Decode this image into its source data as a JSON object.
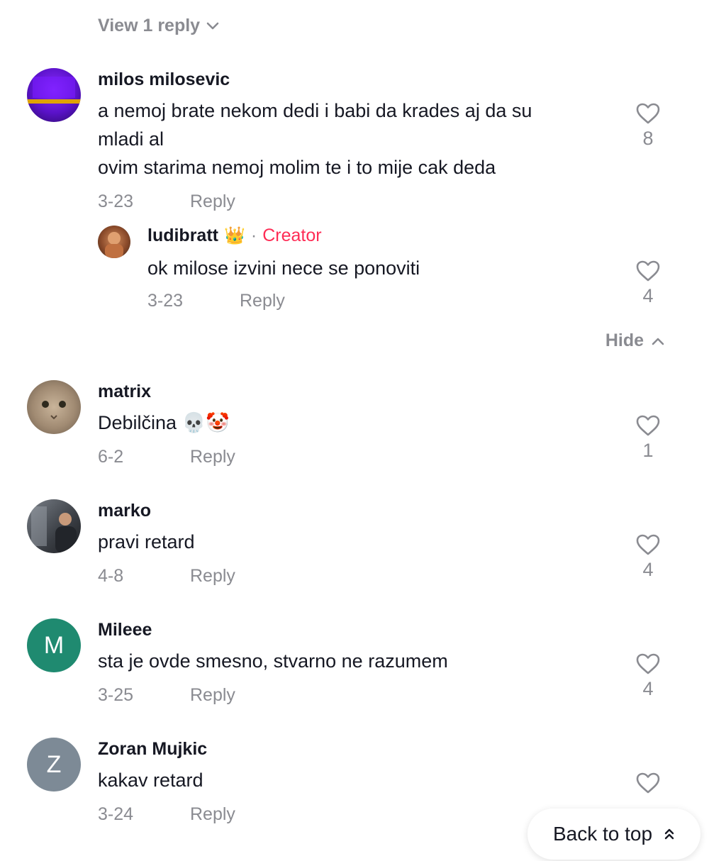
{
  "top": {
    "view_replies_label": "View 1 reply"
  },
  "comments": [
    {
      "username": "milos milosevic",
      "text_line1": "a nemoj brate nekom dedi i babi da krades aj da su",
      "text_line2": "mladi al",
      "text_line3": "ovim starima nemoj molim te i to mije cak deda",
      "date": "3-23",
      "reply_label": "Reply",
      "likes": "8"
    },
    {
      "username": "matrix",
      "text": "Debilčina 💀🤡",
      "date": "6-2",
      "reply_label": "Reply",
      "likes": "1"
    },
    {
      "username": "marko",
      "text": "pravi retard",
      "date": "4-8",
      "reply_label": "Reply",
      "likes": "4"
    },
    {
      "username": "Mileee",
      "avatar_letter": "M",
      "text": "sta je ovde smesno, stvarno ne razumem",
      "date": "3-25",
      "reply_label": "Reply",
      "likes": "4"
    },
    {
      "username": "Zoran Mujkic",
      "avatar_letter": "Z",
      "text": "kakav retard",
      "date": "3-24",
      "reply_label": "Reply"
    }
  ],
  "creator_reply": {
    "username": "ludibratt",
    "crown": "👑",
    "separator": "·",
    "creator_label": "Creator",
    "text": "ok milose izvini nece se ponoviti",
    "date": "3-23",
    "reply_label": "Reply",
    "likes": "4"
  },
  "hide_label": "Hide",
  "back_to_top_label": "Back to top",
  "colors": {
    "creator": "#fe2c55",
    "secondary_text": "#8a8b91",
    "avatar_m": "#1f8a70",
    "avatar_z": "#7d8a96"
  }
}
